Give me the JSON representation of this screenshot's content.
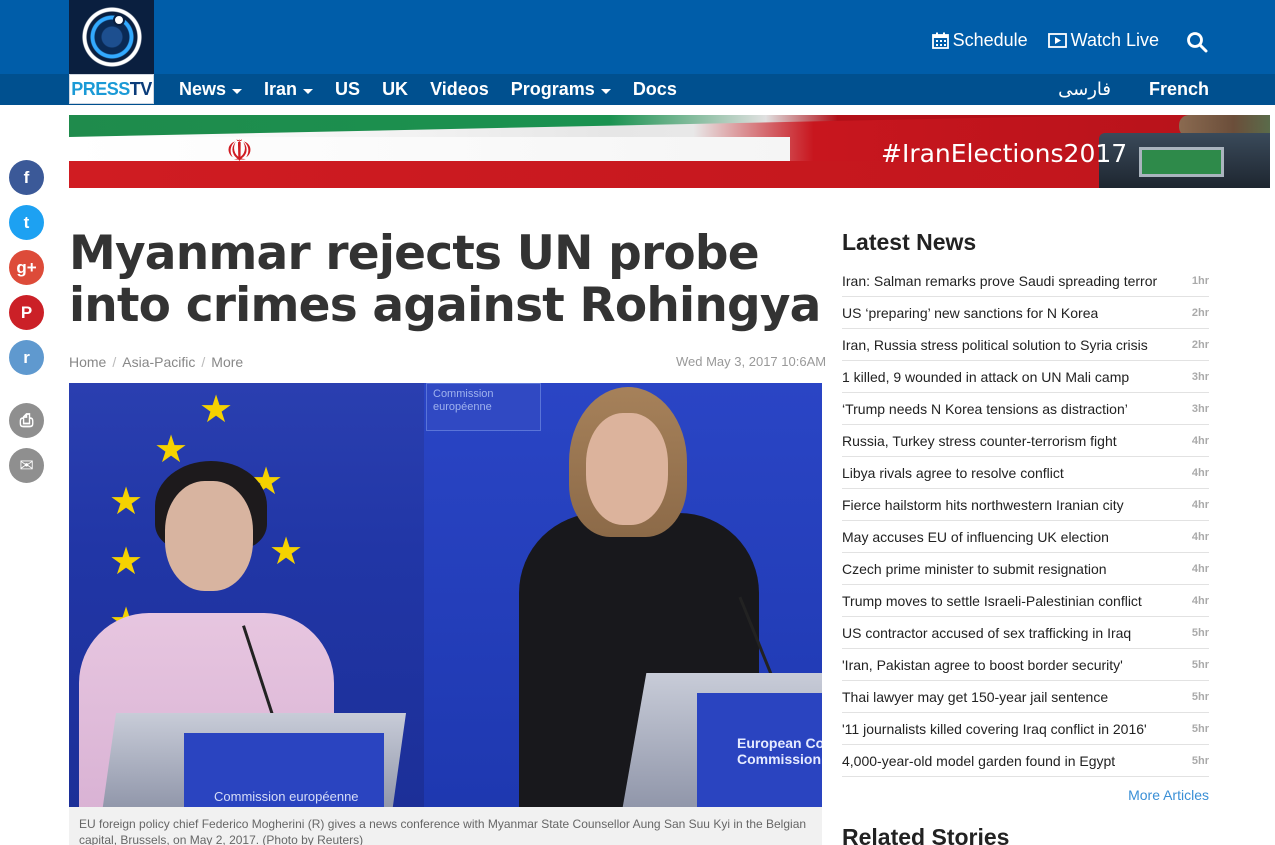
{
  "brand": {
    "logo_text_1": "PRESS",
    "logo_text_2": "TV",
    "color_primary": "#005da9",
    "color_nav": "#00508f"
  },
  "top_links": [
    {
      "label": "Schedule",
      "icon": "calendar-icon"
    },
    {
      "label": "Watch Live",
      "icon": "play-icon"
    }
  ],
  "nav": {
    "items": [
      {
        "label": "News",
        "dropdown": true
      },
      {
        "label": "Iran",
        "dropdown": true
      },
      {
        "label": "US",
        "dropdown": false
      },
      {
        "label": "UK",
        "dropdown": false
      },
      {
        "label": "Videos",
        "dropdown": false
      },
      {
        "label": "Programs",
        "dropdown": true
      },
      {
        "label": "Docs",
        "dropdown": false
      }
    ],
    "lang_fa": "فارسی",
    "lang_fr": "French"
  },
  "banner": {
    "hashtag": "#IranElections2017"
  },
  "share": [
    {
      "icon": "facebook-icon",
      "glyph": "f",
      "color": "#3b5998"
    },
    {
      "icon": "twitter-icon",
      "glyph": "t",
      "color": "#1da1f2"
    },
    {
      "icon": "google-plus-icon",
      "glyph": "g+",
      "color": "#dd4b39"
    },
    {
      "icon": "pinterest-icon",
      "glyph": "P",
      "color": "#cb2027"
    },
    {
      "icon": "reddit-icon",
      "glyph": "r",
      "color": "#5f99cf"
    },
    {
      "icon": "print-icon",
      "glyph": "⎙",
      "color": "#8f8f8f"
    },
    {
      "icon": "email-icon",
      "glyph": "✉",
      "color": "#8f8f8f"
    }
  ],
  "article": {
    "headline": "Myanmar rejects UN probe into crimes against Rohingya",
    "breadcrumb": [
      "Home",
      "Asia-Pacific",
      "More"
    ],
    "dateline": "Wed May 3, 2017 10:6AM",
    "photo_sign": "Commission européenne",
    "podium1_text": "Commission européenne",
    "podium2_text": "European Co Commission",
    "caption": "EU foreign policy chief Federico Mogherini (R) gives a news conference with Myanmar State Counsellor Aung San Suu Kyi in the Belgian capital, Brussels, on May 2, 2017. (Photo by Reuters)"
  },
  "latest": {
    "title": "Latest News",
    "items": [
      {
        "title": "Iran: Salman remarks prove Saudi spreading terror",
        "ago": "1hr"
      },
      {
        "title": "US ‘preparing’ new sanctions for N Korea",
        "ago": "2hr"
      },
      {
        "title": "Iran, Russia stress political solution to Syria crisis",
        "ago": "2hr"
      },
      {
        "title": "1 killed, 9 wounded in attack on UN Mali camp",
        "ago": "3hr"
      },
      {
        "title": "‘Trump needs N Korea tensions as distraction’",
        "ago": "3hr"
      },
      {
        "title": "Russia, Turkey stress counter-terrorism fight",
        "ago": "4hr"
      },
      {
        "title": "Libya rivals agree to resolve conflict",
        "ago": "4hr"
      },
      {
        "title": "Fierce hailstorm hits northwestern Iranian city",
        "ago": "4hr"
      },
      {
        "title": "May accuses EU of influencing UK election",
        "ago": "4hr"
      },
      {
        "title": "Czech prime minister to submit resignation",
        "ago": "4hr"
      },
      {
        "title": "Trump moves to settle Israeli-Palestinian conflict",
        "ago": "4hr"
      },
      {
        "title": "US contractor accused of sex trafficking in Iraq",
        "ago": "5hr"
      },
      {
        "title": "'Iran, Pakistan agree to boost border security'",
        "ago": "5hr"
      },
      {
        "title": "Thai lawyer may get 150-year jail sentence",
        "ago": "5hr"
      },
      {
        "title": "'11 journalists killed covering Iraq conflict in 2016'",
        "ago": "5hr"
      },
      {
        "title": "4,000-year-old model garden found in Egypt",
        "ago": "5hr"
      }
    ],
    "more_label": "More Articles"
  },
  "related_title": "Related Stories"
}
